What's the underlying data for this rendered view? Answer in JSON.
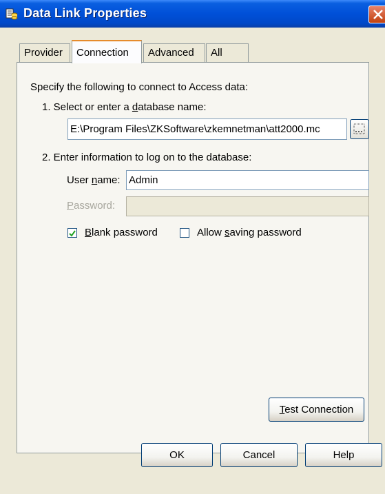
{
  "window": {
    "title": "Data Link Properties",
    "close_icon": "close-icon"
  },
  "tabs": [
    "Provider",
    "Connection",
    "Advanced",
    "All"
  ],
  "active_tab": "Connection",
  "connection": {
    "intro": "Specify the following to connect to Access data:",
    "step1": {
      "pre": "1. Select or enter a ",
      "accel": "d",
      "post": "atabase name:"
    },
    "database_path": "E:\\Program Files\\ZKSoftware\\zkemnetman\\att2000.mc",
    "browse_label": "...",
    "step2": "2. Enter information to log on to the database:",
    "username": {
      "pre": "User ",
      "accel": "n",
      "post": "ame:",
      "value": "Admin"
    },
    "password": {
      "accel": "P",
      "post": "assword:",
      "value": ""
    },
    "blank_password": {
      "accel": "B",
      "post": "lank password",
      "checked": true
    },
    "allow_saving": {
      "pre": "Allow ",
      "accel": "s",
      "post": "aving password",
      "checked": false
    },
    "test_connection": {
      "accel": "T",
      "post": "est Connection"
    }
  },
  "footer": {
    "ok": "OK",
    "cancel": "Cancel",
    "help": "Help"
  }
}
